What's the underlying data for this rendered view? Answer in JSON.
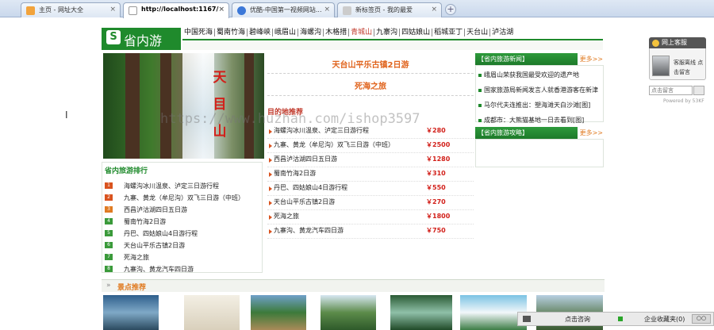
{
  "browser": {
    "tabs": [
      {
        "title": "主页 - 网址大全",
        "icon_color": "#f2a33b",
        "active": false
      },
      {
        "title": "http://localhost:1167/",
        "icon_color": "#ffffff",
        "active": true
      },
      {
        "title": "优酷-中国第一视频网站...",
        "icon_color": "#3c78d8",
        "active": false
      },
      {
        "title": "新标签页 - 我的最爱",
        "icon_color": "#cccccc",
        "active": false
      }
    ],
    "close_glyph": "×",
    "new_tab_glyph": "+"
  },
  "header": {
    "logo_s": "S",
    "logo_text": "省内游",
    "nav": [
      "中国死海",
      "蜀南竹海",
      "碧峰峡",
      "峨眉山",
      "海螺沟",
      "木格措",
      "青城山",
      "九寨沟",
      "四姑娘山",
      "稻城亚丁",
      "天台山",
      "泸沽湖"
    ],
    "nav_highlight_index": 6
  },
  "hero": {
    "caption": [
      "天",
      "目",
      "山"
    ]
  },
  "featured_trip": {
    "title": "天台山平乐古镇2日游",
    "subtitle": "死海之旅"
  },
  "destinations": {
    "heading": "目的地推荐",
    "items": [
      {
        "name": "海螺沟冰川温泉、泸定三日游行程",
        "price": "￥280"
      },
      {
        "name": "九寨、黄龙（牟尼沟）双飞三日游（中班）",
        "price": "￥2500"
      },
      {
        "name": "西昌泸沽湖四日五日游",
        "price": "￥1280"
      },
      {
        "name": "蜀南竹海2日游",
        "price": "￥310"
      },
      {
        "name": "丹巴、四姑娘山4日游行程",
        "price": "￥550"
      },
      {
        "name": "天台山平乐古镇2日游",
        "price": "￥270"
      },
      {
        "name": "死海之旅",
        "price": "￥1800"
      },
      {
        "name": "九寨沟、黄龙汽车四日游",
        "price": "￥750"
      }
    ]
  },
  "ranking": {
    "heading": "省内旅游排行",
    "items": [
      {
        "num": "1",
        "name": "海螺沟冰川温泉、泸定三日游行程",
        "color": "#d9531e"
      },
      {
        "num": "2",
        "name": "九寨、黄龙（牟尼沟）双飞三日游（中班）",
        "color": "#d9531e"
      },
      {
        "num": "3",
        "name": "西昌泸沽湖四日五日游",
        "color": "#e07b22"
      },
      {
        "num": "4",
        "name": "蜀南竹海2日游",
        "color": "#3a9a3a"
      },
      {
        "num": "5",
        "name": "丹巴、四姑娘山4日游行程",
        "color": "#3a9a3a"
      },
      {
        "num": "6",
        "name": "天台山平乐古镇2日游",
        "color": "#3a9a3a"
      },
      {
        "num": "7",
        "name": "死海之旅",
        "color": "#3a9a3a"
      },
      {
        "num": "8",
        "name": "九寨沟、黄龙汽车四日游",
        "color": "#3a9a3a"
      }
    ]
  },
  "news": {
    "heading": "【省内旅游新闻】",
    "more": "更多>>",
    "items": [
      "峨眉山荣获我国最受欢迎的遗产地",
      "国家旅游局新闻发言人就香港游客在新津",
      "马尔代夫连推出：塑海滩天白沙滩[图]",
      "成都市：大熊猫基地一日去看到[图]"
    ]
  },
  "guide": {
    "heading": "【省内旅游攻略】",
    "more": "更多>>"
  },
  "online_service": {
    "title": "网上客服",
    "agent": "客服离线 点击留言",
    "input_placeholder": "点击留言",
    "powered": "Powered by 53KF"
  },
  "featured_spots": {
    "arrow": "»",
    "title": "景点推荐"
  },
  "watermark": "https://www.huzhan.com/ishop3597",
  "chat_bar": {
    "consult": "点击咨询",
    "favorites": "企业收藏夹(0)",
    "side": "○○"
  },
  "colors": {
    "brand_green": "#1f8a2c",
    "orange": "#e0631c",
    "price_red": "#d2201a"
  }
}
